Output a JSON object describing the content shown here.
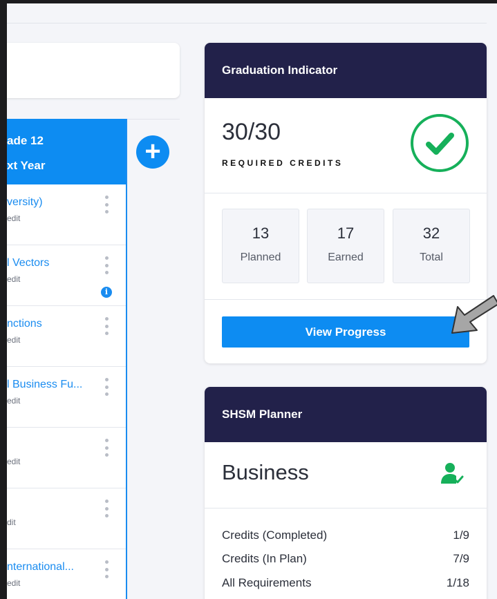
{
  "grade_column": {
    "header_line1": "ade 12",
    "header_line2": "xt Year",
    "courses": [
      {
        "name": "versity)",
        "credit": "edit",
        "info": false
      },
      {
        "name": "l Vectors",
        "credit": "edit",
        "info": true
      },
      {
        "name": "nctions",
        "credit": "edit",
        "info": false
      },
      {
        "name": "l Business Fu...",
        "credit": "edit",
        "info": false
      },
      {
        "name": "",
        "credit": "edit",
        "info": false
      },
      {
        "name": "",
        "credit": "dit",
        "info": false
      },
      {
        "name": "nternational...",
        "credit": "edit",
        "info": false
      }
    ],
    "add_label": "+"
  },
  "graduation": {
    "title": "Graduation Indicator",
    "credits_value": "30/30",
    "credits_label": "REQUIRED CREDITS",
    "stats": [
      {
        "value": "13",
        "label": "Planned"
      },
      {
        "value": "17",
        "label": "Earned"
      },
      {
        "value": "32",
        "label": "Total"
      }
    ],
    "button_label": "View Progress"
  },
  "shsm": {
    "header": "SHSM Planner",
    "title": "Business",
    "rows": [
      {
        "label": "Credits (Completed)",
        "value": "1/9"
      },
      {
        "label": "Credits (In Plan)",
        "value": "7/9"
      },
      {
        "label": "All Requirements",
        "value": "1/18"
      }
    ]
  },
  "colors": {
    "accent": "#0d8cf2",
    "header_navy": "#22214a",
    "success": "#16b05a",
    "arrow_gray": "#a6a6a6"
  }
}
